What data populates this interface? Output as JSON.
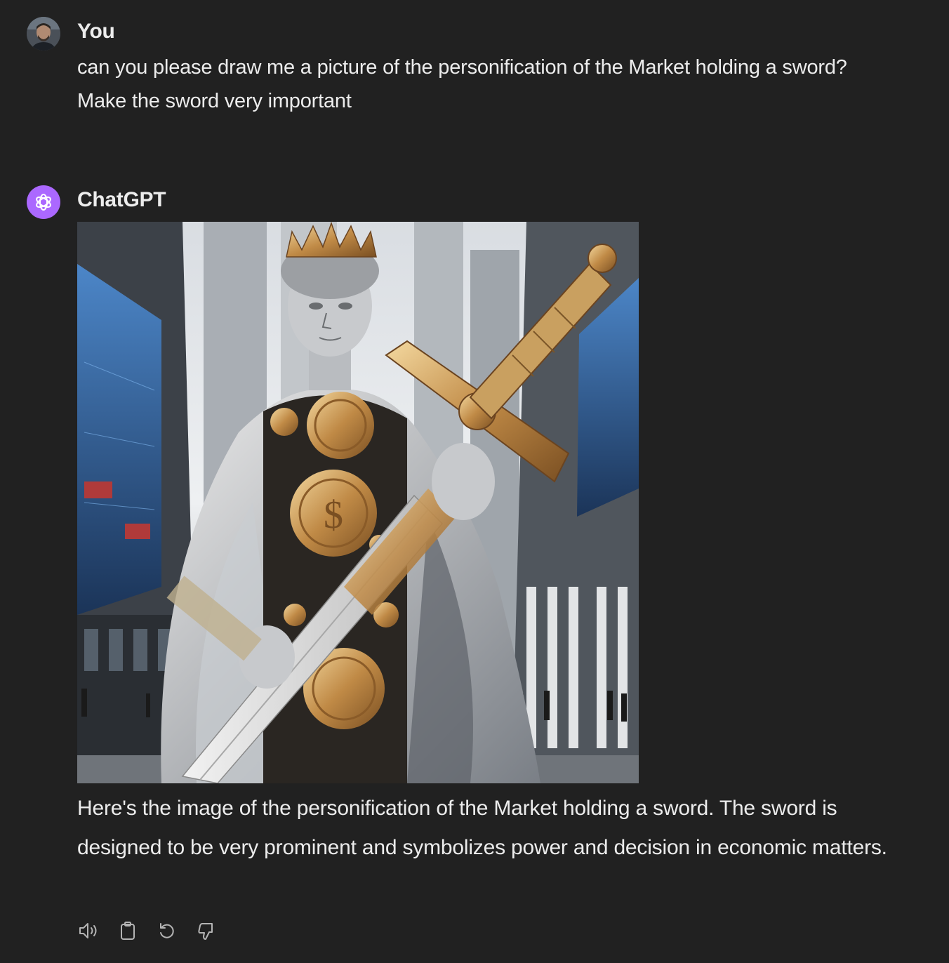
{
  "conversation": {
    "user": {
      "author": "You",
      "message": "can you please draw me a picture of the personification of the Market holding a sword? Make the sword very important"
    },
    "assistant": {
      "author": "ChatGPT",
      "image_alt": "personification of the Market holding a sword",
      "message": "Here's the image of the personification of the Market holding a sword. The sword is designed to be very prominent and symbolizes power and decision in economic matters.",
      "avatar_color": "#ab68ff"
    }
  },
  "actions": {
    "icons": [
      "read-aloud-icon",
      "copy-icon",
      "regenerate-icon",
      "thumbs-down-icon"
    ]
  },
  "colors": {
    "background": "#212121",
    "text": "#ececec",
    "icon": "#b4b4b4"
  }
}
